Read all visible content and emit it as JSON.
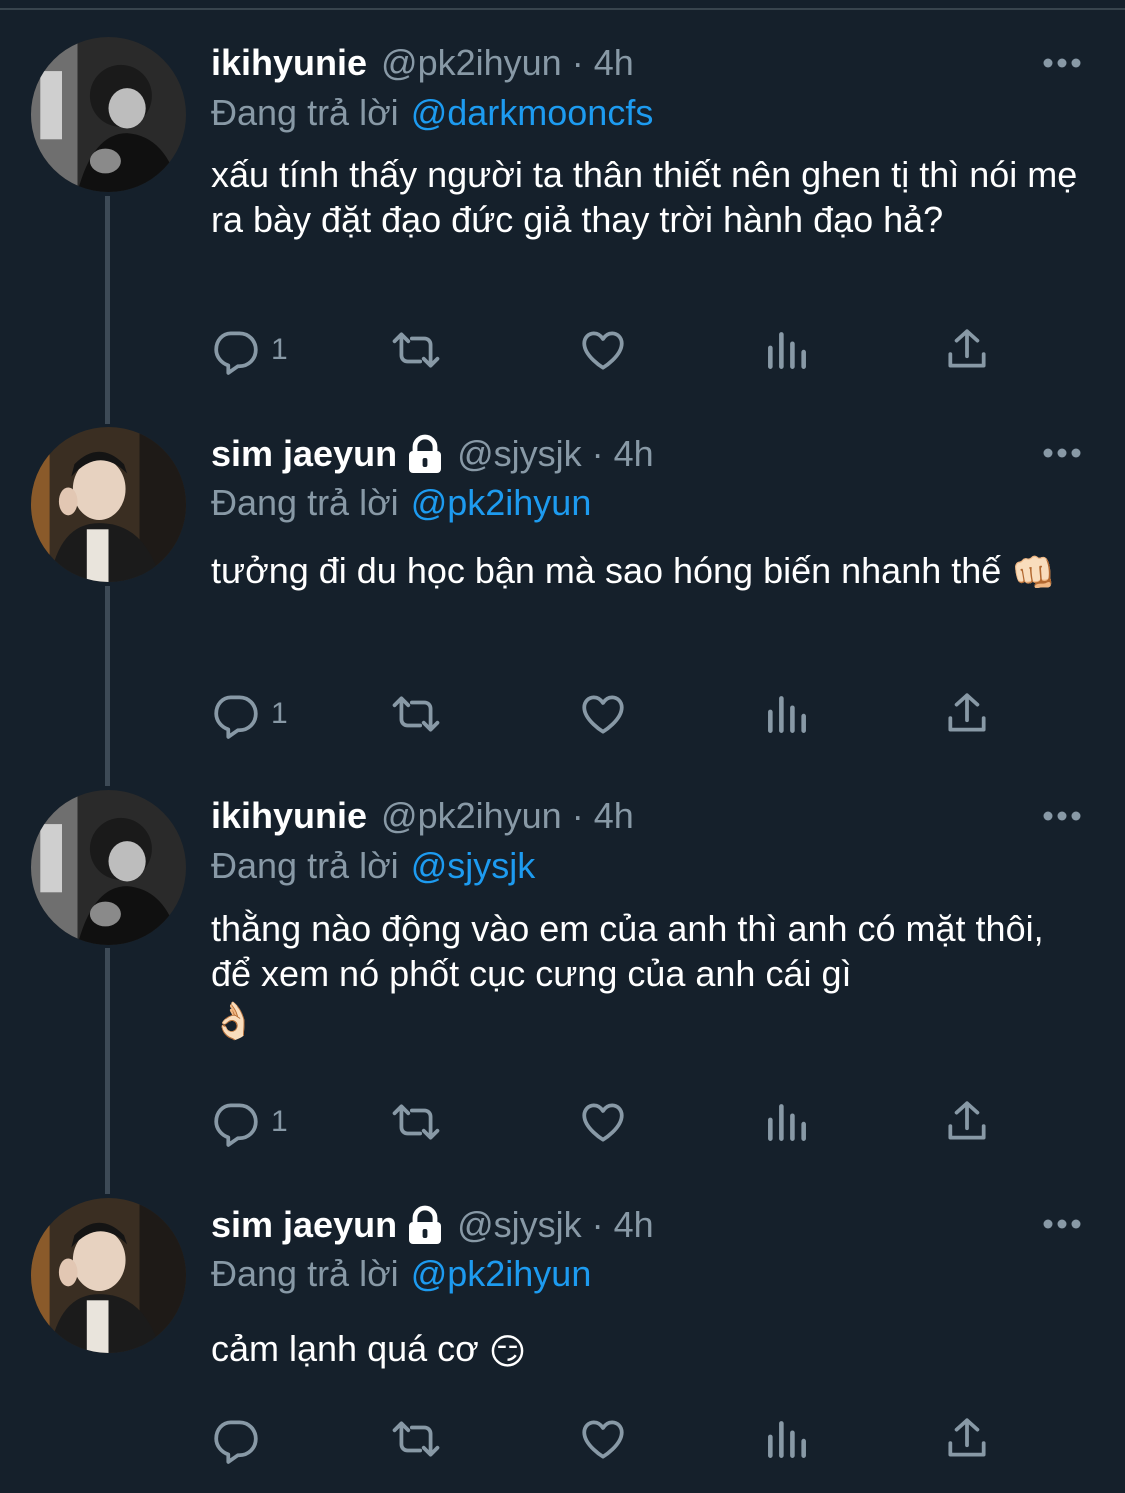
{
  "colors": {
    "background": "#15202b",
    "text_primary": "#ffffff",
    "text_secondary": "#8899a6",
    "accent": "#1d9bf0",
    "thread_line": "#3d4a56"
  },
  "icons": {
    "more": "more-horizontal-icon",
    "lock": "lock-icon",
    "reply": "reply-icon",
    "retweet": "retweet-icon",
    "like": "heart-icon",
    "views": "analytics-icon",
    "share": "share-icon"
  },
  "tweets": [
    {
      "display_name": "ikihyunie",
      "protected": false,
      "handle": "@pk2ihyun",
      "dot": "·",
      "time": "4h",
      "reply_prefix": "Đang trả lời",
      "reply_to": "@darkmooncfs",
      "text": "xấu tính thấy người ta thân thiết nên ghen tị thì nói mẹ ra bày đặt đạo đức giả thay trời hành đạo hả?",
      "emoji": "",
      "reply_count": "1"
    },
    {
      "display_name": "sim jaeyun",
      "protected": true,
      "handle": "@sjysjk",
      "dot": "·",
      "time": "4h",
      "reply_prefix": "Đang trả lời",
      "reply_to": "@pk2ihyun",
      "text": "tưởng đi du học bận mà sao hóng biến nhanh thế",
      "emoji": "👊🏻",
      "reply_count": "1"
    },
    {
      "display_name": "ikihyunie",
      "protected": false,
      "handle": "@pk2ihyun",
      "dot": "·",
      "time": "4h",
      "reply_prefix": "Đang trả lời",
      "reply_to": "@sjysjk",
      "text": "thằng nào động vào em của anh thì anh có mặt thôi, để xem nó phốt cục cưng của anh cái gì",
      "emoji": "👌🏻",
      "reply_count": "1"
    },
    {
      "display_name": "sim jaeyun",
      "protected": true,
      "handle": "@sjysjk",
      "dot": "·",
      "time": "4h",
      "reply_prefix": "Đang trả lời",
      "reply_to": "@pk2ihyun",
      "text": "cảm lạnh quá cơ",
      "emoji": "😏",
      "reply_count": ""
    }
  ]
}
